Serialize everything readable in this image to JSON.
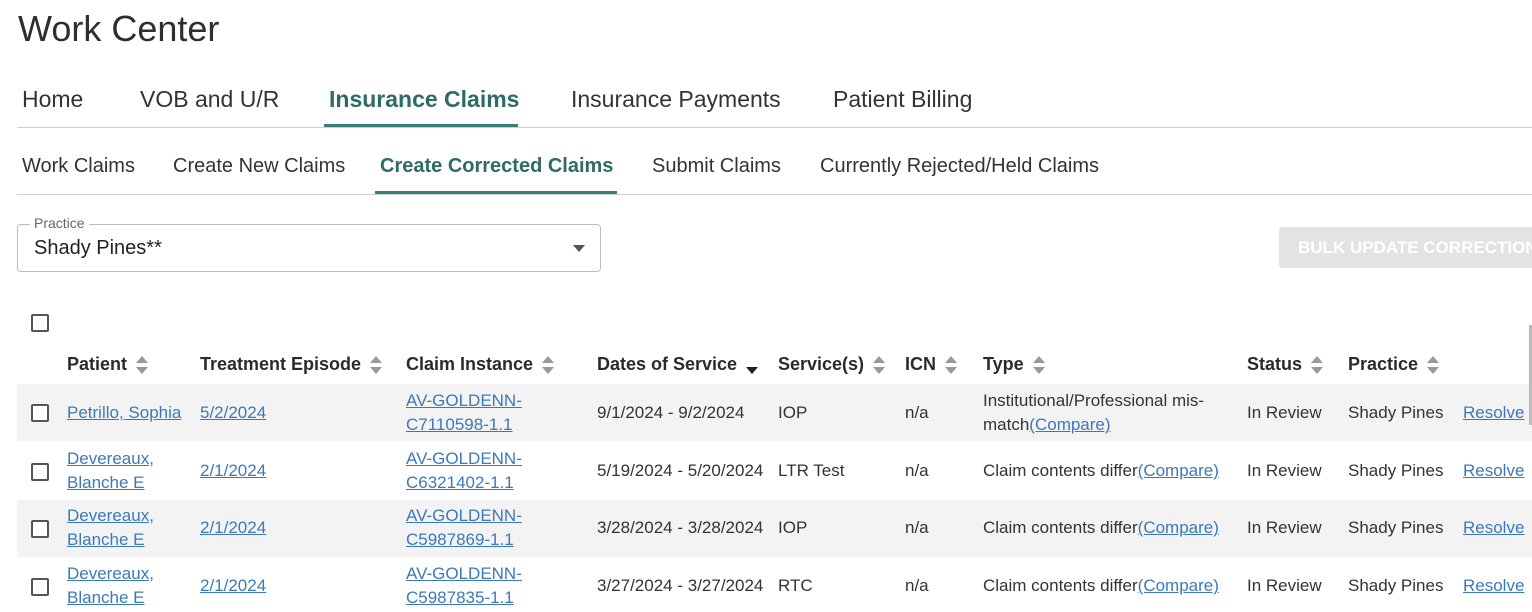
{
  "app": {
    "title": "Work Center"
  },
  "tabs": [
    {
      "label": "Home"
    },
    {
      "label": "VOB and U/R"
    },
    {
      "label": "Insurance Claims"
    },
    {
      "label": "Insurance Payments"
    },
    {
      "label": "Patient Billing"
    }
  ],
  "subtabs": [
    {
      "label": "Work Claims"
    },
    {
      "label": "Create New Claims"
    },
    {
      "label": "Create Corrected Claims"
    },
    {
      "label": "Submit Claims"
    },
    {
      "label": "Currently Rejected/Held Claims"
    }
  ],
  "filter": {
    "label": "Practice",
    "value": "Shady Pines**"
  },
  "bulk_button": {
    "label": "BULK UPDATE CORRECTIONS"
  },
  "table": {
    "headers": {
      "patient": "Patient",
      "episode": "Treatment Episode",
      "claim": "Claim Instance",
      "dates": "Dates of Service",
      "services": "Service(s)",
      "icn": "ICN",
      "type": "Type",
      "status": "Status",
      "practice": "Practice"
    },
    "rows": [
      {
        "patient": [
          "Petrillo, Sophia"
        ],
        "episode": "5/2/2024",
        "claim": [
          "AV-GOLDENN-",
          "C7110598-1.1"
        ],
        "dates": "9/1/2024 - 9/2/2024",
        "services": "IOP",
        "icn": "n/a",
        "type_line1": "Institutional/Professional mis-",
        "type_text": "match",
        "compare": "(Compare)",
        "status": "In Review",
        "practice": "Shady Pines",
        "action": "Resolve"
      },
      {
        "patient": [
          "Devereaux,",
          "Blanche E"
        ],
        "episode": "2/1/2024",
        "claim": [
          "AV-GOLDENN-",
          "C6321402-1.1"
        ],
        "dates": "5/19/2024 - 5/20/2024",
        "services": "LTR Test",
        "icn": "n/a",
        "type_line1": "",
        "type_text": "Claim contents differ",
        "compare": "(Compare)",
        "status": "In Review",
        "practice": "Shady Pines",
        "action": "Resolve"
      },
      {
        "patient": [
          "Devereaux,",
          "Blanche E"
        ],
        "episode": "2/1/2024",
        "claim": [
          "AV-GOLDENN-",
          "C5987869-1.1"
        ],
        "dates": "3/28/2024 - 3/28/2024",
        "services": "IOP",
        "icn": "n/a",
        "type_line1": "",
        "type_text": "Claim contents differ",
        "compare": "(Compare)",
        "status": "In Review",
        "practice": "Shady Pines",
        "action": "Resolve"
      },
      {
        "patient": [
          "Devereaux,",
          "Blanche E"
        ],
        "episode": "2/1/2024",
        "claim": [
          "AV-GOLDENN-",
          "C5987835-1.1"
        ],
        "dates": "3/27/2024 - 3/27/2024",
        "services": "RTC",
        "icn": "n/a",
        "type_line1": "",
        "type_text": "Claim contents differ",
        "compare": "(Compare)",
        "status": "In Review",
        "practice": "Shady Pines",
        "action": "Resolve"
      }
    ]
  }
}
